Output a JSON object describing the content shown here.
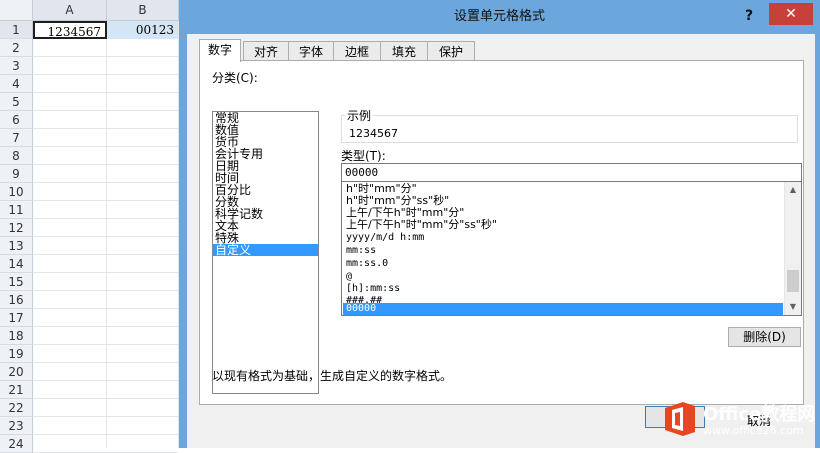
{
  "spreadsheet": {
    "columns": [
      "A",
      "B"
    ],
    "rows": [
      "1",
      "2",
      "3",
      "4",
      "5",
      "6",
      "7",
      "8",
      "9",
      "10",
      "11",
      "12",
      "13",
      "14",
      "15",
      "16",
      "17",
      "18",
      "19",
      "20",
      "21",
      "22",
      "23",
      "24"
    ],
    "cells": {
      "a1": "1234567",
      "b1": "00123"
    }
  },
  "dialog": {
    "title": "设置单元格格式",
    "help": "?",
    "close": "✕",
    "tabs": [
      "数字",
      "对齐",
      "字体",
      "边框",
      "填充",
      "保护"
    ],
    "active_tab": "数字",
    "category_label": "分类(C):",
    "categories": [
      "常规",
      "数值",
      "货币",
      "会计专用",
      "日期",
      "时间",
      "百分比",
      "分数",
      "科学记数",
      "文本",
      "特殊",
      "自定义"
    ],
    "selected_category": "自定义",
    "sample_label": "示例",
    "sample_value": "1234567",
    "type_label": "类型(T):",
    "type_value": "00000",
    "formats": [
      "h\"时\"mm\"分\"",
      "h\"时\"mm\"分\"ss\"秒\"",
      "上午/下午h\"时\"mm\"分\"",
      "上午/下午h\"时\"mm\"分\"ss\"秒\"",
      "yyyy/m/d h:mm",
      "mm:ss",
      "mm:ss.0",
      "@",
      "[h]:mm:ss",
      "###.##",
      "00000"
    ],
    "selected_format": "00000",
    "delete_label": "删除(D)",
    "description": "以现有格式为基础，生成自定义的数字格式。",
    "cancel_label": "取消"
  },
  "watermark": {
    "name": "Office教程网",
    "url": "www.office26.com"
  },
  "colors": {
    "selection": "#3399ff",
    "close": "#c7413a",
    "frame": "#6ba6dc",
    "logo": "#e6471e"
  }
}
